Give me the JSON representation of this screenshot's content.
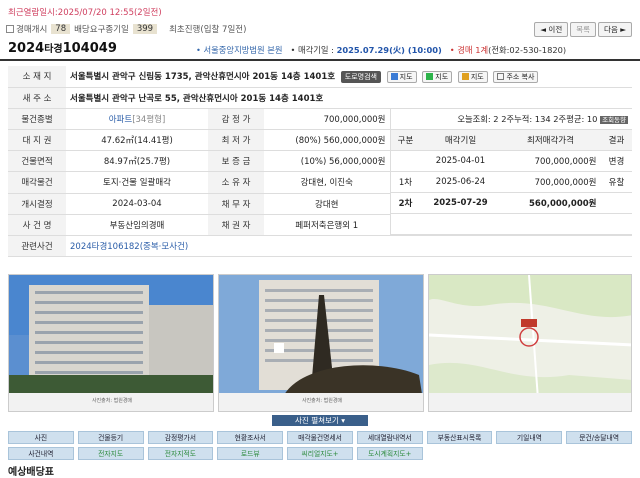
{
  "top": {
    "recent": "최근열람일시:2025/07/20 12:55(2일전)"
  },
  "row2": {
    "open_label": "경매개시",
    "open_count": "78",
    "dividend_label": "배당요구종기일",
    "dividend_count": "399",
    "first": "최초진행(입찰 7일전)"
  },
  "nav": {
    "prev": "◄ 이전",
    "list": "목록",
    "next": "다음 ►"
  },
  "case": {
    "year": "2024",
    "kind": "타경",
    "num": "104049",
    "court": "• 서울중앙지방법원 본원",
    "date_label": "• 매각기일 :",
    "date": "2025.07.29(火) (10:00)",
    "dept": "• 경매 1계",
    "tel": "(전화:02-530-1820)"
  },
  "rows": {
    "addr_label": "소 재 지",
    "addr": "서울특별시 관악구 신림동 1735, 관악산휴먼시아 201동 14층 1401호",
    "roadsearch": "도로명검색",
    "map1": "지도",
    "map2": "지도",
    "map3": "지도",
    "copy": "주소 복사",
    "newaddr_label": "새 주 소",
    "newaddr": "서울특별시 관악구 난곡로 55, 관악산휴먼시아 201동 14층 1401호",
    "type_label": "물건종별",
    "type": "아파트",
    "type_pyeong": "[34평형]",
    "appr_label": "감 정 가",
    "appr": "700,000,000원",
    "views": "오늘조회: 2  2주누적: 134  2주평균: 10",
    "views_btn": "조회동향",
    "land_label": "대 지 권",
    "land": "47.62㎡(14.41평)",
    "min_label": "최 저 가",
    "min": "(80%) 560,000,000원",
    "bld_label": "건물면적",
    "bld": "84.97㎡(25.7평)",
    "dep_label": "보 증 금",
    "dep": "(10%) 56,000,000원",
    "sale_label": "매각물건",
    "sale": "토지·건물 일괄매각",
    "owner_label": "소 유 자",
    "owner": "강대현, 이진숙",
    "start_label": "개시결정",
    "start": "2024-03-04",
    "debtor_label": "채 무 자",
    "debtor": "강대현",
    "casename_label": "사 건 명",
    "casename": "부동산임의경매",
    "creditor_label": "채 권 자",
    "creditor": "페퍼저축은행외 1",
    "related_label": "관련사건",
    "related": "2024타경106182(중복·모사건)"
  },
  "hist": {
    "h": [
      "구분",
      "매각기일",
      "최저매각가격",
      "결과"
    ],
    "rows": [
      [
        "",
        "2025-04-01",
        "700,000,000원",
        "변경"
      ],
      [
        "1차",
        "2025-06-24",
        "700,000,000원",
        "유찰"
      ],
      [
        "2차",
        "2025-07-29",
        "560,000,000원",
        ""
      ]
    ]
  },
  "photos": {
    "cap1": "사진출처: 법원경매",
    "cap2": "사진출처: 법원경매",
    "toggle": "사진 펼쳐보기"
  },
  "buttons": [
    "사진",
    "건물등기",
    "감정평가서",
    "현황조사서",
    "매각물건명세서",
    "세대열람내역서",
    "부동산표시목록",
    "기일내역",
    "문건/송달내역",
    "사건내역",
    "전자지도",
    "전자지적도",
    "로드뷰",
    "씨리얼지도+",
    "도시계획지도+"
  ],
  "footer": "예상배당표"
}
